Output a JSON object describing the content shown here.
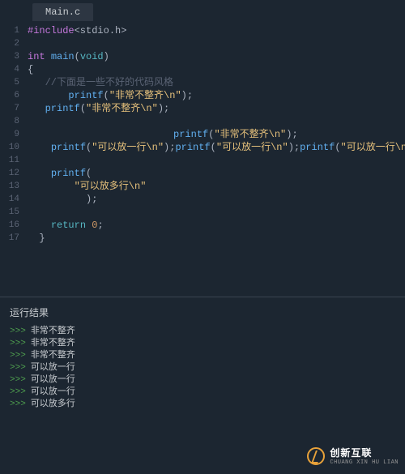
{
  "tab": {
    "title": "Main.c"
  },
  "code": {
    "lines": [
      {
        "num": "1",
        "fold": true,
        "tokens": [
          [
            "tok-preproc",
            "#include"
          ],
          [
            "tok-default",
            "<stdio.h>"
          ]
        ]
      },
      {
        "num": "2",
        "fold": false,
        "tokens": []
      },
      {
        "num": "3",
        "fold": false,
        "tokens": [
          [
            "tok-type",
            "int"
          ],
          [
            "tok-default",
            " "
          ],
          [
            "tok-func",
            "main"
          ],
          [
            "tok-punct",
            "("
          ],
          [
            "tok-keyword",
            "void"
          ],
          [
            "tok-punct",
            ")"
          ]
        ]
      },
      {
        "num": "4",
        "fold": true,
        "tokens": [
          [
            "tok-punct",
            "{"
          ]
        ]
      },
      {
        "num": "5",
        "fold": false,
        "tokens": [
          [
            "tok-default",
            "   "
          ],
          [
            "tok-comment",
            "//下面是一些不好的代码风格"
          ]
        ]
      },
      {
        "num": "6",
        "fold": false,
        "tokens": [
          [
            "tok-default",
            "       "
          ],
          [
            "tok-func",
            "printf"
          ],
          [
            "tok-punct",
            "("
          ],
          [
            "tok-string",
            "\"非常不整齐\\n\""
          ],
          [
            "tok-punct",
            ");"
          ]
        ]
      },
      {
        "num": "7",
        "fold": false,
        "tokens": [
          [
            "tok-default",
            "   "
          ],
          [
            "tok-func",
            "printf"
          ],
          [
            "tok-punct",
            "("
          ],
          [
            "tok-string",
            "\"非常不整齐\\n\""
          ],
          [
            "tok-punct",
            ");"
          ]
        ]
      },
      {
        "num": "8",
        "fold": false,
        "tokens": []
      },
      {
        "num": "9",
        "fold": false,
        "tokens": [
          [
            "tok-default",
            "                         "
          ],
          [
            "tok-func",
            "printf"
          ],
          [
            "tok-punct",
            "("
          ],
          [
            "tok-string",
            "\"非常不整齐\\n\""
          ],
          [
            "tok-punct",
            ");"
          ]
        ]
      },
      {
        "num": "10",
        "fold": false,
        "tokens": [
          [
            "tok-default",
            "    "
          ],
          [
            "tok-func",
            "printf"
          ],
          [
            "tok-punct",
            "("
          ],
          [
            "tok-string",
            "\"可以放一行\\n\""
          ],
          [
            "tok-punct",
            ");"
          ],
          [
            "tok-func",
            "printf"
          ],
          [
            "tok-punct",
            "("
          ],
          [
            "tok-string",
            "\"可以放一行\\n\""
          ],
          [
            "tok-punct",
            ");"
          ],
          [
            "tok-func",
            "printf"
          ],
          [
            "tok-punct",
            "("
          ],
          [
            "tok-string",
            "\"可以放一行\\n\""
          ],
          [
            "tok-punct",
            ");"
          ]
        ]
      },
      {
        "num": "11",
        "fold": false,
        "tokens": []
      },
      {
        "num": "12",
        "fold": false,
        "tokens": [
          [
            "tok-default",
            "    "
          ],
          [
            "tok-func",
            "printf"
          ],
          [
            "tok-punct",
            "("
          ]
        ]
      },
      {
        "num": "13",
        "fold": false,
        "tokens": [
          [
            "tok-default",
            "        "
          ],
          [
            "tok-string",
            "\"可以放多行\\n\""
          ]
        ]
      },
      {
        "num": "14",
        "fold": false,
        "tokens": [
          [
            "tok-default",
            "          "
          ],
          [
            "tok-punct",
            ");"
          ]
        ]
      },
      {
        "num": "15",
        "fold": false,
        "tokens": []
      },
      {
        "num": "16",
        "fold": false,
        "tokens": [
          [
            "tok-default",
            "    "
          ],
          [
            "tok-keyword",
            "return"
          ],
          [
            "tok-default",
            " "
          ],
          [
            "tok-num",
            "0"
          ],
          [
            "tok-punct",
            ";"
          ]
        ]
      },
      {
        "num": "17",
        "fold": false,
        "tokens": [
          [
            "tok-default",
            "  "
          ],
          [
            "tok-punct",
            "}"
          ]
        ]
      }
    ]
  },
  "output": {
    "title": "运行结果",
    "prompt": ">>>",
    "lines": [
      "非常不整齐",
      "非常不整齐",
      "非常不整齐",
      "可以放一行",
      "可以放一行",
      "可以放一行",
      "可以放多行"
    ]
  },
  "watermark": {
    "main": "创新互联",
    "sub": "CHUANG XIN HU LIAN"
  }
}
